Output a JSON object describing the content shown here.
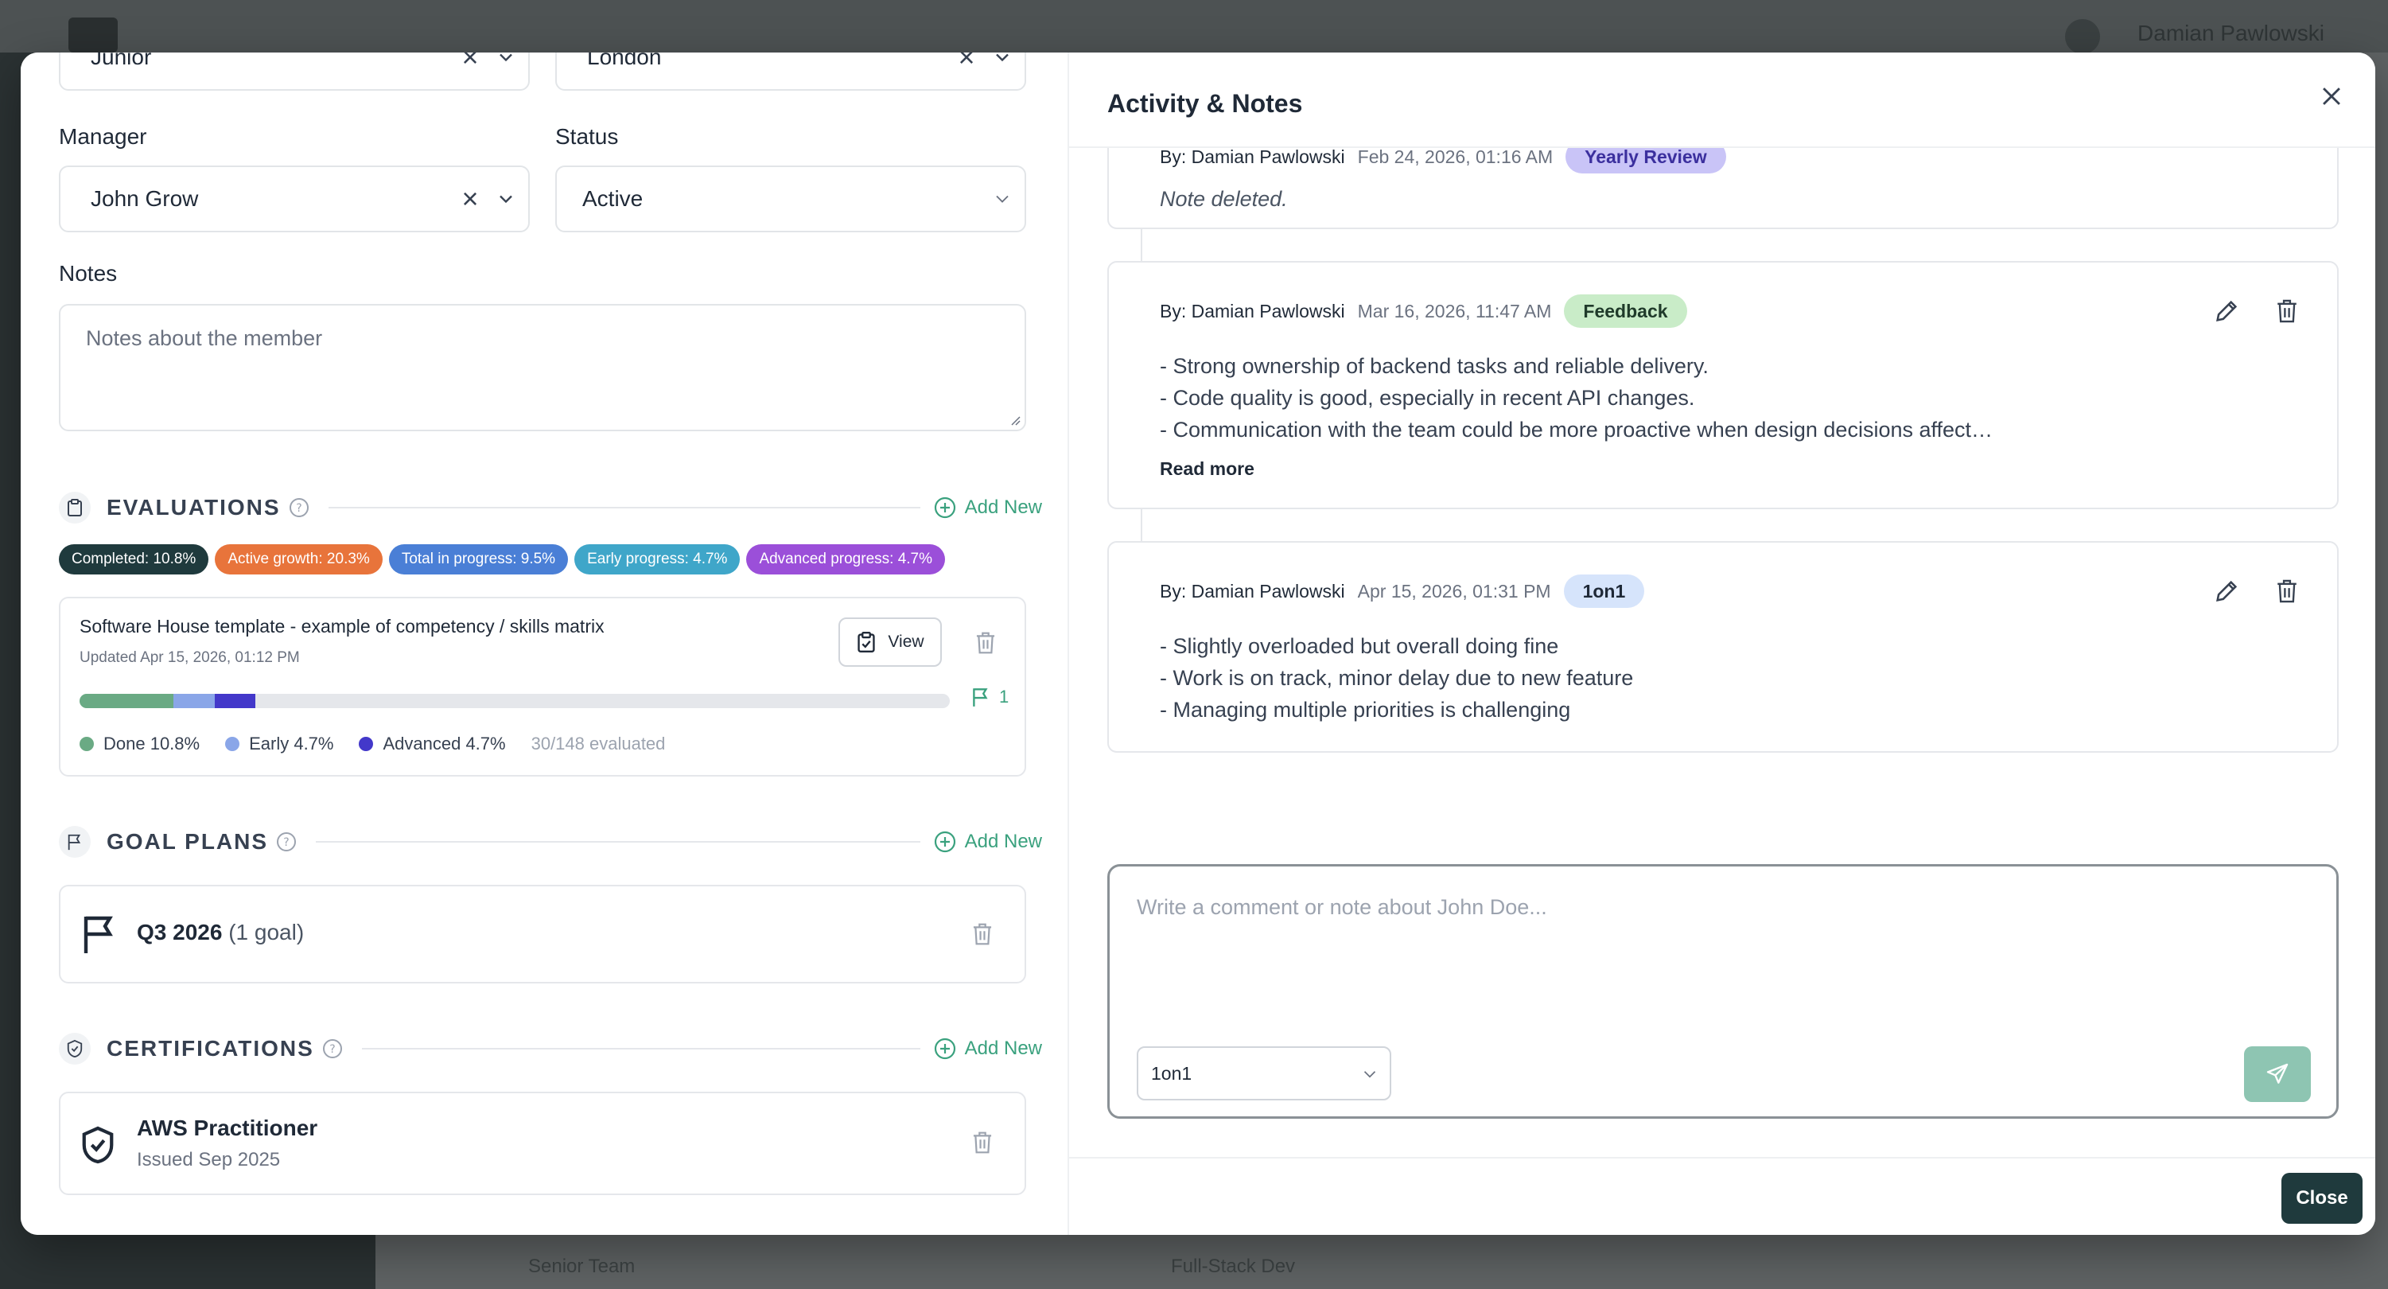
{
  "background": {
    "user_name": "Damian Pawlowski",
    "footer_left": "Senior Team",
    "footer_right": "Full-Stack Dev"
  },
  "form": {
    "level_value": "Junior",
    "location_value": "London",
    "manager_label": "Manager",
    "manager_value": "John Grow",
    "status_label": "Status",
    "status_value": "Active",
    "notes_label": "Notes",
    "notes_placeholder": "Notes about the member"
  },
  "evaluations": {
    "title": "EVALUATIONS",
    "add_new": "Add New",
    "chips": [
      {
        "label": "Completed: 10.8%",
        "color": "#1f3a3d"
      },
      {
        "label": "Active growth: 20.3%",
        "color": "#e8743b"
      },
      {
        "label": "Total in progress: 9.5%",
        "color": "#4a7fd6"
      },
      {
        "label": "Early progress: 4.7%",
        "color": "#3fa6c9"
      },
      {
        "label": "Advanced progress: 4.7%",
        "color": "#9b4fd9"
      }
    ],
    "card": {
      "title": "Software House template - example of competency / skills matrix",
      "updated": "Updated Apr 15, 2026, 01:12 PM",
      "view_label": "View",
      "flag_count": "1",
      "progress": {
        "done": 10.8,
        "early": 4.7,
        "advanced": 4.7
      },
      "colors": {
        "done": "#6aaa84",
        "early": "#8aa6e8",
        "advanced": "#4338ca"
      },
      "legend_done": "Done 10.8%",
      "legend_early": "Early 4.7%",
      "legend_advanced": "Advanced 4.7%",
      "evaluated": "30/148 evaluated"
    }
  },
  "goal_plans": {
    "title": "GOAL PLANS",
    "add_new": "Add New",
    "plan_title": "Q3 2026",
    "plan_sub": "(1 goal)"
  },
  "certifications": {
    "title": "CERTIFICATIONS",
    "add_new": "Add New",
    "cert_title": "AWS Practitioner",
    "cert_sub": "Issued Sep 2025"
  },
  "activity": {
    "title": "Activity & Notes",
    "notes": [
      {
        "by": "By: Damian Pawlowski",
        "date": "Feb 24, 2026, 01:16 AM",
        "tag": "Yearly Review",
        "tag_bg": "#c9c4f7",
        "tag_fg": "#3b2f9e",
        "body": "Note deleted."
      },
      {
        "by": "By: Damian Pawlowski",
        "date": "Mar 16, 2026, 11:47 AM",
        "tag": "Feedback",
        "tag_bg": "#c9ecc8",
        "tag_fg": "#1f3a2a",
        "lines": [
          "- Strong ownership of backend tasks and reliable delivery.",
          "- Code quality is good, especially in recent API changes.",
          "- Communication with the team could be more proactive when design decisions affect…"
        ],
        "read_more": "Read more"
      },
      {
        "by": "By: Damian Pawlowski",
        "date": "Apr 15, 2026, 01:31 PM",
        "tag": "1on1",
        "tag_bg": "#d6e4fb",
        "tag_fg": "#1f2937",
        "lines": [
          "- Slightly overloaded but overall doing fine",
          "- Work is on track, minor delay due to new feature",
          "- Managing multiple priorities is challenging"
        ]
      }
    ],
    "composer_placeholder": "Write a comment or note about John Doe...",
    "composer_type": "1on1",
    "close_label": "Close"
  }
}
